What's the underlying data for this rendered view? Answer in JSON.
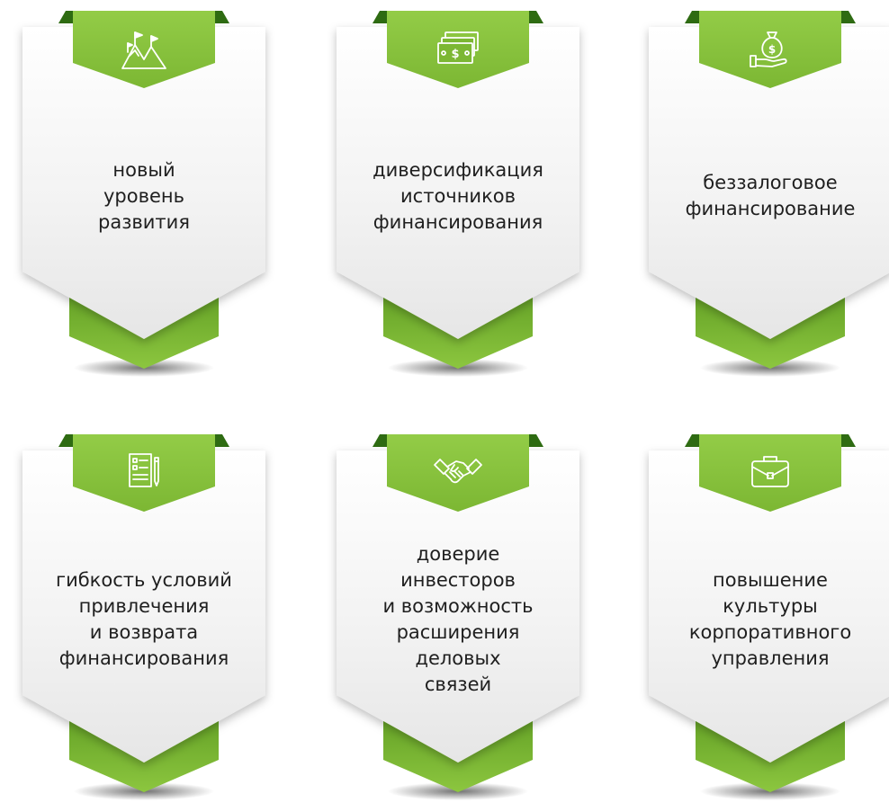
{
  "cards": [
    {
      "icon": "mountains-flags-icon",
      "label": "новый\nуровень\nразвития"
    },
    {
      "icon": "banknotes-icon",
      "label": "диверсификация\nисточников\nфинансирования"
    },
    {
      "icon": "money-bag-hand-icon",
      "label": "беззалоговое\nфинансирование"
    },
    {
      "icon": "document-pencil-icon",
      "label": "гибкость условий\nпривлечения\nи возврата\nфинансирования"
    },
    {
      "icon": "handshake-icon",
      "label": "доверие\nинвесторов\nи возможность\nрасширения\nделовых\nсвязей"
    },
    {
      "icon": "briefcase-icon",
      "label": "повышение\nкультуры\nкорпоративного\nуправления"
    }
  ],
  "colors": {
    "green_light": "#8cc63f",
    "green_mid": "#6fb02a",
    "green_dark": "#2e6b12",
    "card_top": "#ffffff",
    "card_bottom": "#e9e9e9",
    "text": "#1f1f1f"
  }
}
